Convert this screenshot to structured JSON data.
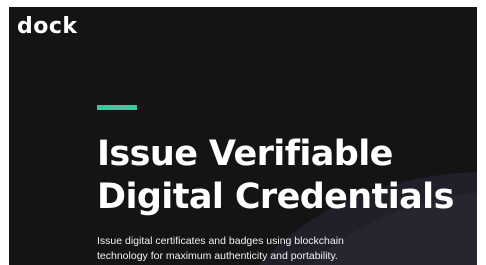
{
  "brand": {
    "logo_text": "dock"
  },
  "hero": {
    "headline_line1": "Issue Verifiable",
    "headline_line2": "Digital Credentials",
    "subtext_line1": "Issue digital certificates and badges using blockchain",
    "subtext_line2": "technology for maximum authenticity and portability."
  },
  "colors": {
    "background": "#141414",
    "accent": "#3ec6a0",
    "text": "#ffffff",
    "swoosh": "#23242e"
  }
}
